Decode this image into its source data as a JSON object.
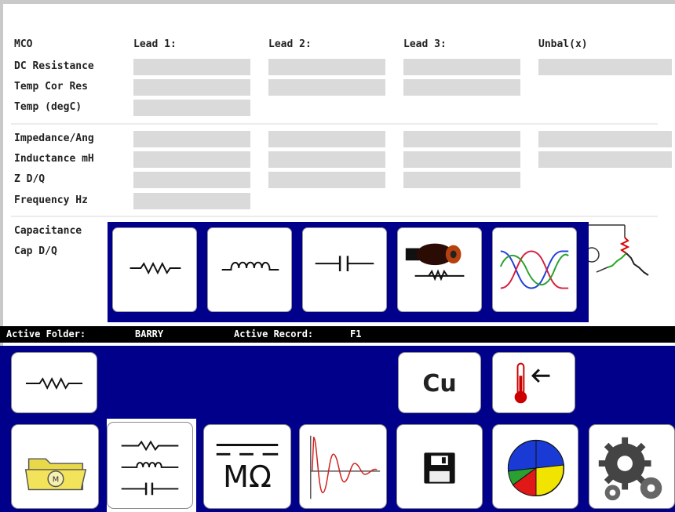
{
  "table": {
    "header": {
      "row_label": "MCO",
      "col1": "Lead 1:",
      "col2": "Lead 2:",
      "col3": "Lead 3:",
      "col4": "Unbal(x)"
    },
    "group1": [
      "DC Resistance",
      "Temp Cor Res",
      "Temp (degC)"
    ],
    "group2": [
      "Impedance/Ang",
      "Inductance mH",
      "Z D/Q",
      "Frequency Hz"
    ],
    "group3": [
      "Capacitance",
      "Cap D/Q"
    ]
  },
  "status": {
    "folder_label": "Active Folder:",
    "folder_value": "BARRY",
    "record_label": "Active Record:",
    "record_value": "F1"
  },
  "popup_tiles": [
    "resistor-icon",
    "inductor-icon",
    "capacitor-icon",
    "motor-cable-icon",
    "three-phase-waveform-icon"
  ],
  "toolbar_top": {
    "resistor": "resistor-icon",
    "copper": "Cu",
    "temperature": "thermometer-icon"
  },
  "toolbar_bottom": {
    "megohm_label": "MΩ",
    "items": [
      "folder-motor-icon",
      "rlc-icon",
      "megohm-icon",
      "ringing-waveform-icon",
      "save-disk-icon",
      "pie-chart-icon",
      "gears-icon"
    ]
  },
  "colors": {
    "panel_blue": "#00008a",
    "cell_grey": "#dadada",
    "status_bar": "#000000"
  }
}
